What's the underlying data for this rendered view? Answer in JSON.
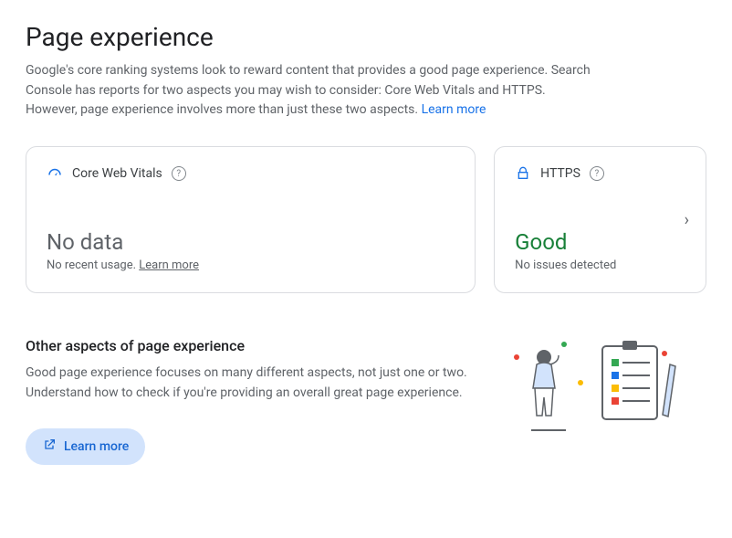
{
  "page": {
    "title": "Page experience",
    "intro": "Google's core ranking systems look to reward content that provides a good page experience. Search Console has reports for two aspects you may wish to consider: Core Web Vitals and HTTPS. However, page experience involves more than just these two aspects. ",
    "intro_link": "Learn more"
  },
  "cards": {
    "cwv": {
      "title": "Core Web Vitals",
      "status": "No data",
      "sub_prefix": "No recent usage. ",
      "sub_link": "Learn more"
    },
    "https": {
      "title": "HTTPS",
      "status": "Good",
      "sub": "No issues detected"
    }
  },
  "other": {
    "heading": "Other aspects of page experience",
    "body": "Good page experience focuses on many different aspects, not just one or two. Understand how to check if you're providing an overall great page experience.",
    "button": "Learn more"
  }
}
